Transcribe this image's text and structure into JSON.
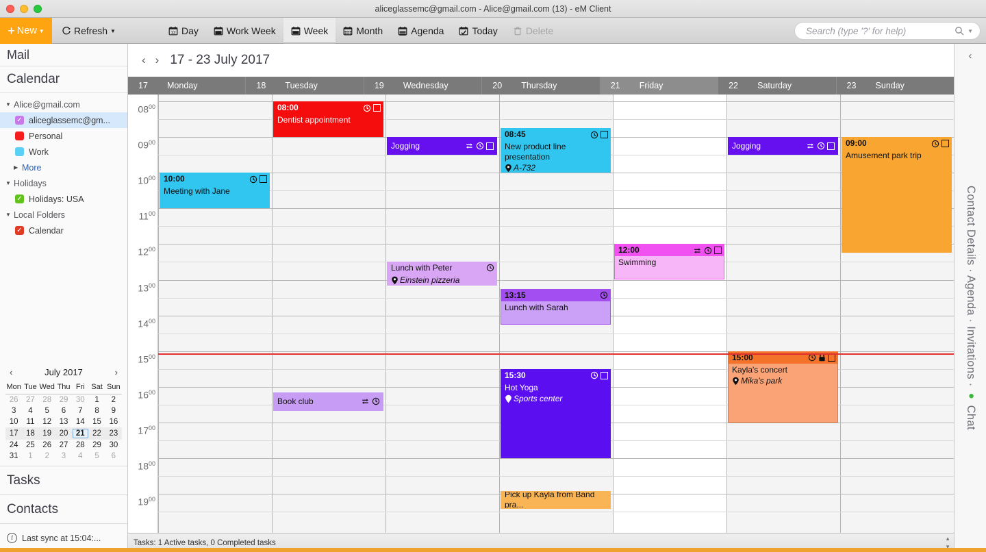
{
  "window": {
    "title": "aliceglassemc@gmail.com - Alice@gmail.com (13) - eM Client"
  },
  "toolbar": {
    "new_label": "New",
    "refresh_label": "Refresh",
    "tabs": [
      {
        "label": "Day",
        "icon": "calendar-day-icon",
        "active": false
      },
      {
        "label": "Work Week",
        "icon": "calendar-workweek-icon",
        "active": false
      },
      {
        "label": "Week",
        "icon": "calendar-week-icon",
        "active": true
      },
      {
        "label": "Month",
        "icon": "calendar-month-icon",
        "active": false
      },
      {
        "label": "Agenda",
        "icon": "agenda-icon",
        "active": false
      },
      {
        "label": "Today",
        "icon": "calendar-today-icon",
        "active": false
      },
      {
        "label": "Delete",
        "icon": "trash-icon",
        "active": false,
        "disabled": true
      }
    ],
    "search_placeholder": "Search (type '?' for help)",
    "search_value": ""
  },
  "sidebar": {
    "section_mail": "Mail",
    "section_calendar": "Calendar",
    "section_tasks": "Tasks",
    "section_contacts": "Contacts",
    "sync_status": "Last sync at 15:04:...",
    "folders": [
      {
        "label": "Alice@gmail.com",
        "type": "account",
        "expanded": true
      },
      {
        "label": "aliceglassemc@gm...",
        "type": "calendar",
        "color": "#c77ae8",
        "checked": true,
        "selected": true
      },
      {
        "label": "Personal",
        "type": "calendar",
        "color": "#f51d1d",
        "checked": false
      },
      {
        "label": "Work",
        "type": "calendar",
        "color": "#5ad0f5",
        "checked": false
      },
      {
        "label": "More",
        "type": "more",
        "expanded": false
      },
      {
        "label": "Holidays",
        "type": "account",
        "expanded": true
      },
      {
        "label": "Holidays: USA",
        "type": "calendar",
        "color": "#62c31a",
        "checked": true
      },
      {
        "label": "Local Folders",
        "type": "account",
        "expanded": true
      },
      {
        "label": "Calendar",
        "type": "calendar",
        "color": "#e03b24",
        "checked": true
      }
    ]
  },
  "minicalendar": {
    "title": "July 2017",
    "prev": "‹",
    "next": "›",
    "weekday_headers": [
      "Mon",
      "Tue",
      "Wed",
      "Thu",
      "Fri",
      "Sat",
      "Sun"
    ],
    "today": 21,
    "current_week_index": 3,
    "weeks": [
      [
        {
          "d": 26,
          "dim": true
        },
        {
          "d": 27,
          "dim": true
        },
        {
          "d": 28,
          "dim": true
        },
        {
          "d": 29,
          "dim": true
        },
        {
          "d": 30,
          "dim": true
        },
        {
          "d": 1,
          "dim": false
        },
        {
          "d": 2,
          "dim": false
        }
      ],
      [
        {
          "d": 3,
          "dim": false
        },
        {
          "d": 4,
          "dim": false
        },
        {
          "d": 5,
          "dim": false
        },
        {
          "d": 6,
          "dim": false
        },
        {
          "d": 7,
          "dim": false
        },
        {
          "d": 8,
          "dim": false
        },
        {
          "d": 9,
          "dim": false
        }
      ],
      [
        {
          "d": 10,
          "dim": false
        },
        {
          "d": 11,
          "dim": false
        },
        {
          "d": 12,
          "dim": false
        },
        {
          "d": 13,
          "dim": false
        },
        {
          "d": 14,
          "dim": false
        },
        {
          "d": 15,
          "dim": false
        },
        {
          "d": 16,
          "dim": false
        }
      ],
      [
        {
          "d": 17,
          "dim": false
        },
        {
          "d": 18,
          "dim": false
        },
        {
          "d": 19,
          "dim": false
        },
        {
          "d": 20,
          "dim": false
        },
        {
          "d": 21,
          "dim": false
        },
        {
          "d": 22,
          "dim": false
        },
        {
          "d": 23,
          "dim": false
        }
      ],
      [
        {
          "d": 24,
          "dim": false
        },
        {
          "d": 25,
          "dim": false
        },
        {
          "d": 26,
          "dim": false
        },
        {
          "d": 27,
          "dim": false
        },
        {
          "d": 28,
          "dim": false
        },
        {
          "d": 29,
          "dim": false
        },
        {
          "d": 30,
          "dim": false
        }
      ],
      [
        {
          "d": 31,
          "dim": false
        },
        {
          "d": 1,
          "dim": true
        },
        {
          "d": 2,
          "dim": true
        },
        {
          "d": 3,
          "dim": true
        },
        {
          "d": 4,
          "dim": true
        },
        {
          "d": 5,
          "dim": true
        },
        {
          "d": 6,
          "dim": true
        }
      ]
    ]
  },
  "calendar": {
    "range_label": "17 - 23 July 2017",
    "prev_arrow": "‹",
    "next_arrow": "›",
    "today_column_index": 4,
    "days": [
      {
        "num": "17",
        "name": "Monday"
      },
      {
        "num": "18",
        "name": "Tuesday"
      },
      {
        "num": "19",
        "name": "Wednesday"
      },
      {
        "num": "20",
        "name": "Thursday"
      },
      {
        "num": "21",
        "name": "Friday"
      },
      {
        "num": "22",
        "name": "Saturday"
      },
      {
        "num": "23",
        "name": "Sunday"
      }
    ],
    "hours": [
      "08",
      "09",
      "10",
      "11",
      "12",
      "13",
      "14",
      "15",
      "16",
      "17",
      "18",
      "19"
    ],
    "hour_minutes": "00",
    "now_time": "15:04",
    "status_text": "Tasks: 1 Active tasks, 0 Completed tasks",
    "events": [
      {
        "id": "dentist",
        "day": 1,
        "start": "08:00",
        "end": "09:00",
        "time_label": "08:00",
        "title": "Dentist appointment",
        "location": "",
        "bg": "#f50c0c",
        "header_bg": "#f50c0c",
        "text": "#ffffff",
        "layout": "full",
        "recurring": false,
        "alarm": true,
        "private": false,
        "checkbox": true
      },
      {
        "id": "jogging-wed",
        "day": 2,
        "start": "09:00",
        "end": "09:30",
        "time_label": "",
        "title": "Jogging",
        "location": "",
        "bg": "#6610f0",
        "header_bg": "#6610f0",
        "text": "#ffffff",
        "layout": "compact",
        "recurring": true,
        "alarm": true,
        "private": false,
        "checkbox": true
      },
      {
        "id": "product-line",
        "day": 3,
        "start": "08:45",
        "end": "10:00",
        "time_label": "08:45",
        "title": "New product line presentation",
        "location": "A-732",
        "bg": "#31c6f0",
        "header_bg": "#31c6f0",
        "text": "#101010",
        "layout": "full",
        "recurring": false,
        "alarm": true,
        "private": false,
        "checkbox": true
      },
      {
        "id": "jogging-sat",
        "day": 5,
        "start": "09:00",
        "end": "09:30",
        "time_label": "",
        "title": "Jogging",
        "location": "",
        "bg": "#6610f0",
        "header_bg": "#6610f0",
        "text": "#ffffff",
        "layout": "compact",
        "recurring": true,
        "alarm": true,
        "private": false,
        "checkbox": true
      },
      {
        "id": "amusement",
        "day": 6,
        "start": "09:00",
        "end": "12:15",
        "time_label": "09:00",
        "title": "Amusement park trip",
        "location": "",
        "bg": "#f9a532",
        "header_bg": "#f9a532",
        "text": "#101010",
        "layout": "full",
        "recurring": false,
        "alarm": true,
        "private": false,
        "checkbox": true
      },
      {
        "id": "meeting-jane",
        "day": 0,
        "start": "10:00",
        "end": "11:00",
        "time_label": "10:00",
        "title": "Meeting with Jane",
        "location": "",
        "bg": "#31c6f0",
        "header_bg": "#31c6f0",
        "text": "#101010",
        "layout": "full",
        "recurring": false,
        "alarm": true,
        "private": false,
        "checkbox": true
      },
      {
        "id": "swimming",
        "day": 4,
        "start": "12:00",
        "end": "13:00",
        "time_label": "12:00",
        "title": "Swimming",
        "location": "",
        "bg": "#f7b6f7",
        "header_bg": "#f151f1",
        "text": "#101010",
        "layout": "full",
        "recurring": true,
        "alarm": true,
        "private": false,
        "checkbox": true
      },
      {
        "id": "lunch-peter",
        "day": 2,
        "start": "12:30",
        "end": "13:10",
        "time_label": "",
        "title": "Lunch with Peter",
        "location": "Einstein pizzeria",
        "bg": "#d9a6f5",
        "header_bg": "#d9a6f5",
        "text": "#101010",
        "layout": "noheader",
        "recurring": false,
        "alarm": true,
        "private": false,
        "checkbox": false
      },
      {
        "id": "lunch-sarah",
        "day": 3,
        "start": "13:15",
        "end": "14:15",
        "time_label": "13:15",
        "title": "Lunch with Sarah",
        "location": "",
        "bg": "#cba0f7",
        "header_bg": "#a24ef0",
        "text": "#101010",
        "layout": "full",
        "recurring": false,
        "alarm": true,
        "private": false,
        "checkbox": false
      },
      {
        "id": "kayla-concert",
        "day": 5,
        "start": "15:00",
        "end": "17:00",
        "time_label": "15:00",
        "title": "Kayla's concert",
        "location": "Mika's park",
        "bg": "#f9a377",
        "header_bg": "#f4732b",
        "text": "#101010",
        "layout": "full",
        "recurring": false,
        "alarm": true,
        "private": true,
        "checkbox": true
      },
      {
        "id": "hot-yoga",
        "day": 3,
        "start": "15:30",
        "end": "18:00",
        "time_label": "15:30",
        "title": "Hot Yoga",
        "location": "Sports center",
        "bg": "#5b0ff0",
        "header_bg": "#5b0ff0",
        "text": "#ffffff",
        "layout": "full",
        "recurring": false,
        "alarm": true,
        "private": false,
        "checkbox": true
      },
      {
        "id": "book-club",
        "day": 1,
        "start": "16:10",
        "end": "16:40",
        "time_label": "",
        "title": "Book club",
        "location": "",
        "bg": "#c79cf5",
        "header_bg": "#c79cf5",
        "text": "#101010",
        "layout": "compact",
        "recurring": true,
        "alarm": true,
        "private": false,
        "checkbox": false
      },
      {
        "id": "pick-up-kayla",
        "day": 3,
        "start": "18:55",
        "end": "19:25",
        "time_label": "",
        "title": "Pick up Kayla from Band pra...",
        "location": "",
        "bg": "#f9b555",
        "header_bg": "#f9b555",
        "text": "#101010",
        "layout": "compact",
        "recurring": false,
        "alarm": false,
        "private": false,
        "checkbox": false
      }
    ]
  },
  "rightrail": {
    "collapse_arrow": "‹",
    "labels": [
      "Contact Details",
      "Agenda",
      "Invitations",
      "Chat"
    ],
    "separator": "·",
    "chat_status_color": "#3fb83f",
    "vertical_text": "Contact Details  ·  Agenda  ·  Invitations  ·  "
  }
}
